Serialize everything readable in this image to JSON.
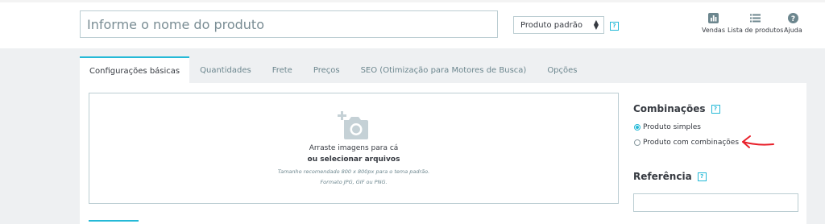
{
  "header": {
    "product_name_placeholder": "Informe o nome do produto",
    "product_type_selected": "Produto padrão",
    "help_symbol": "?",
    "tools": [
      {
        "label": "Vendas",
        "icon": "bar-chart-icon"
      },
      {
        "label": "Lista de produtos",
        "icon": "list-icon"
      },
      {
        "label": "Ajuda",
        "icon": "question-circle-icon"
      }
    ]
  },
  "tabs": [
    {
      "label": "Configurações básicas",
      "active": true
    },
    {
      "label": "Quantidades"
    },
    {
      "label": "Frete"
    },
    {
      "label": "Preços"
    },
    {
      "label": "SEO (Otimização para Motores de Busca)"
    },
    {
      "label": "Opções"
    }
  ],
  "dropzone": {
    "icon": "add-photo-icon",
    "title": "Arraste imagens para cá",
    "link": "ou selecionar arquivos",
    "note_size": "Tamanho recomendado 800 x 800px para o tema padrão.",
    "note_format": "Formato JPG, GIF ou PNG."
  },
  "combinations": {
    "title": "Combinações",
    "options": [
      {
        "label": "Produto simples",
        "checked": true
      },
      {
        "label": "Produto com combinações",
        "checked": false
      }
    ]
  },
  "reference": {
    "title": "Referência",
    "value": ""
  },
  "colors": {
    "accent": "#25b9d7",
    "annotation_arrow": "#e8202a"
  }
}
